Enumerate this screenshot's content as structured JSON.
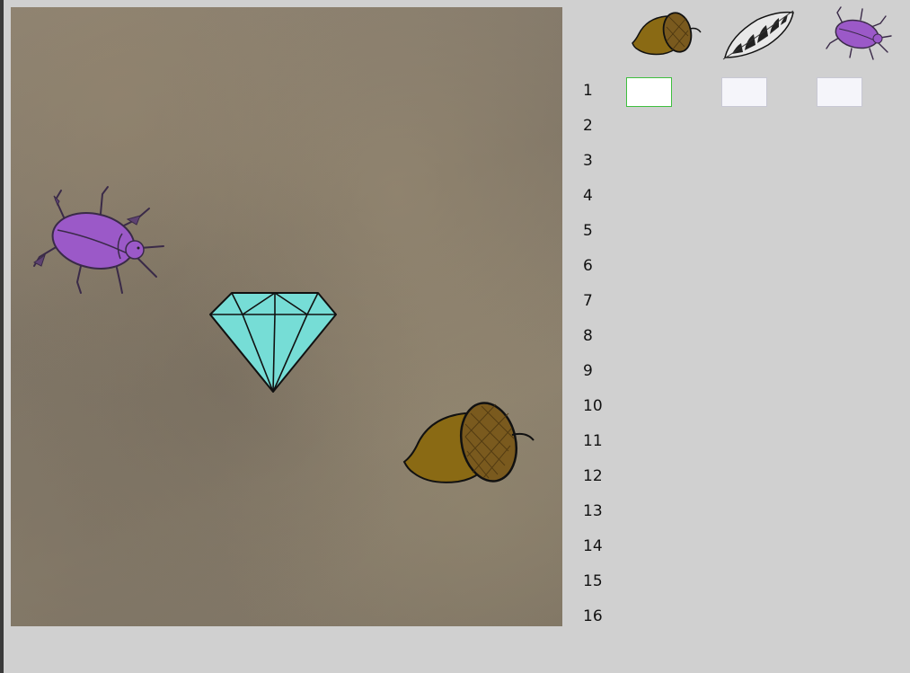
{
  "columns": [
    {
      "icon": "acorn-icon",
      "value": ""
    },
    {
      "icon": "feather-icon",
      "value": ""
    },
    {
      "icon": "beetle-icon",
      "value": ""
    }
  ],
  "rows": [
    "1",
    "2",
    "3",
    "4",
    "5",
    "6",
    "7",
    "8",
    "9",
    "10",
    "11",
    "12",
    "13",
    "14",
    "15",
    "16"
  ],
  "board_objects": [
    "beetle-icon",
    "diamond-icon",
    "acorn-icon"
  ],
  "colors": {
    "board": "#857a6a",
    "beetle": "#9b59c8",
    "diamond": "#76ddd6",
    "acorn_body": "#8a6a14",
    "acorn_cap": "#7a5a1e",
    "active_border": "#3fbf3f"
  }
}
